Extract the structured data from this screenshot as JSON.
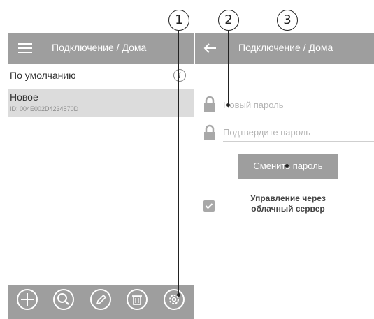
{
  "left_panel": {
    "title": "Подключение / Дома",
    "items": [
      {
        "label": "По умолчанию"
      },
      {
        "label": "Новое",
        "device_id": "ID: 004E002D4234570D"
      }
    ],
    "toolbar": [
      "add-icon",
      "search-icon",
      "edit-icon",
      "delete-icon",
      "settings-icon"
    ]
  },
  "right_panel": {
    "title": "Подключение / Дома",
    "new_password_placeholder": "Новый пароль",
    "confirm_password_placeholder": "Подтвердите пароль",
    "change_button": "Сменить пароль",
    "cloud_checkbox_checked": true,
    "cloud_label": "Управление через облачный сервер"
  },
  "callouts": [
    "1",
    "2",
    "3"
  ],
  "colors": {
    "bar": "#9e9e9e",
    "selected_row": "#dcdcdc"
  }
}
